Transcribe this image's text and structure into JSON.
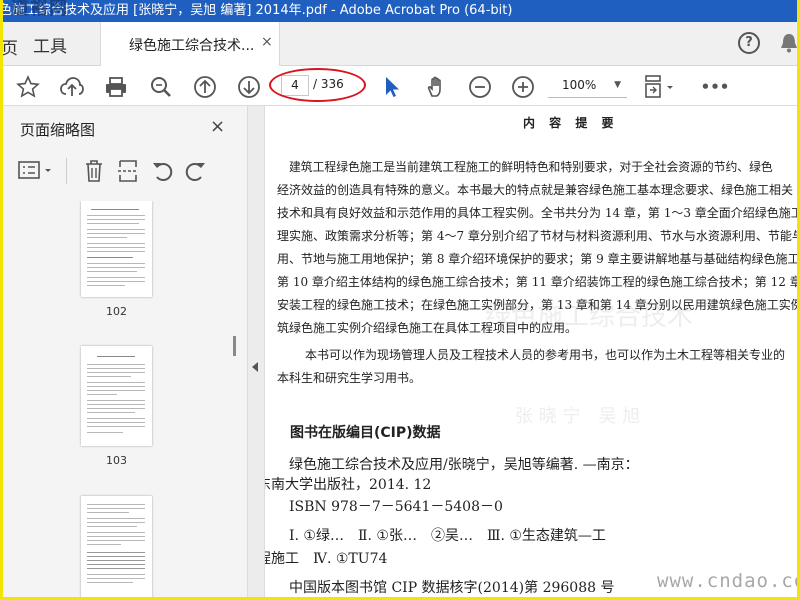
{
  "window": {
    "title": "色施工综合技术及应用 [张晓宁，吴旭 编著] 2014年.pdf - Adobe Acrobat Pro (64-bit)",
    "watermark_logo": "道裕网"
  },
  "tabs": {
    "partial_left": "页",
    "tools": "工具",
    "document": "绿色施工综合技术...",
    "document_close": "×"
  },
  "toolbar": {
    "page_current": "4",
    "page_total": "/ 336",
    "zoom": "100%",
    "more": "•••"
  },
  "sidebar": {
    "title": "页面缩略图",
    "close": "×",
    "thumbnails": [
      {
        "label": "102"
      },
      {
        "label": "103"
      },
      {
        "label": ""
      }
    ]
  },
  "document": {
    "heading": "内 容 提 要",
    "summary_lines": [
      "建筑工程绿色施工是当前建筑工程施工的鲜明特色和特别要求，对于全社会资源的节约、绿色",
      "经济效益的创造具有特殊的意义。本书最大的特点就是兼容绿色施工基本理念要求、绿色施工相关",
      "技术和具有良好效益和示范作用的具体工程实例。全书共分为 14 章，第 1～3 章全面介绍绿色施工",
      "理实施、政策需求分析等；第 4～7 章分别介绍了节材与材料资源利用、节水与水资源利用、节能与",
      "用、节地与施工用地保护；第 8 章介绍环境保护的要求；第 9 章主要讲解地基与基础结构绿色施工综",
      "第 10 章介绍主体结构的绿色施工综合技术；第 11 章介绍装饰工程的绿色施工综合技术；第 12 章介",
      "安装工程的绿色施工技术；在绿色施工实例部分，第 13 章和第 14 章分别以民用建筑绿色施工实例和",
      "筑绿色施工实例介绍绿色施工在具体工程项目中的应用。"
    ],
    "audience_lines": [
      "本书可以作为现场管理人员及工程技术人员的参考用书，也可以作为土木工程等相关专业的",
      "本科生和研究生学习用书。"
    ],
    "cip_title": "图书在版编目(CIP)数据",
    "cip_lines": [
      "绿色施工综合技术及应用/张晓宁，吴旭等编著. —南京：",
      "东南大学出版社，2014. 12",
      "ISBN 978－7－5641－5408－0",
      "Ⅰ. ①绿…　Ⅱ. ①张…　②吴…　Ⅲ. ①生态建筑—工",
      "程施工　Ⅳ. ①TU74",
      "中国版本图书馆 CIP 数据核字(2014)第 296088 号"
    ]
  },
  "site_watermark": "www.cndao.com",
  "colors": {
    "outer_border": "#f2e600",
    "titlebar": "#1f5fbf",
    "annotation_oval": "#d8141e",
    "select_tool": "#1f5fbf"
  }
}
